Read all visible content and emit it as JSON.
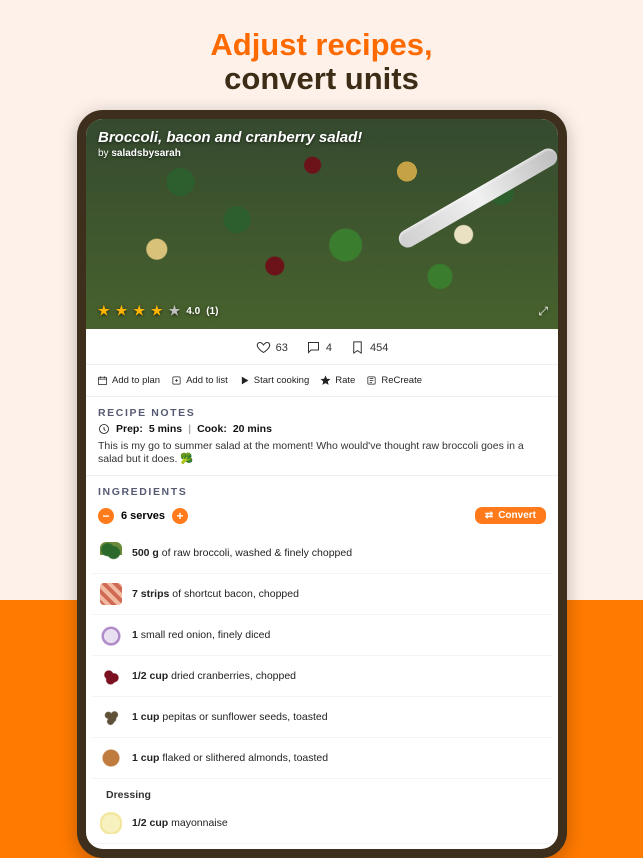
{
  "promo": {
    "line1": "Adjust recipes,",
    "line2": "convert units"
  },
  "hero": {
    "title": "Broccoli, bacon and cranberry salad!",
    "by_prefix": "by ",
    "author": "saladsbysarah",
    "rating_value": "4.0",
    "rating_count": "(1)"
  },
  "engagement": {
    "likes": "63",
    "comments": "4",
    "saves": "454"
  },
  "actions": {
    "add_to_plan": "Add to plan",
    "add_to_list": "Add to list",
    "start_cooking": "Start cooking",
    "rate": "Rate",
    "recreate": "ReCreate"
  },
  "notes": {
    "heading": "RECIPE NOTES",
    "prep_label": "Prep:",
    "prep_value": "5 mins",
    "cook_label": "Cook:",
    "cook_value": "20 mins",
    "text": "This is my go to summer salad at the moment! Who would've thought raw broccoli goes in a salad but it does. 🥦"
  },
  "ingredients_section": {
    "heading": "INGREDIENTS",
    "serves_label": "6 serves",
    "convert_label": "Convert",
    "items": [
      {
        "qty": "500 g",
        "rest": " of raw broccoli, washed & finely chopped"
      },
      {
        "qty": "7 strips",
        "rest": " of shortcut bacon, chopped"
      },
      {
        "qty": "1",
        "rest": " small red onion, finely diced"
      },
      {
        "qty": "1/2 cup",
        "rest": " dried cranberries, chopped"
      },
      {
        "qty": "1 cup",
        "rest": " pepitas or sunflower seeds, toasted"
      },
      {
        "qty": "1 cup",
        "rest": " flaked or slithered almonds, toasted"
      }
    ],
    "dressing_heading": "Dressing",
    "dressing_items": [
      {
        "qty": "1/2 cup",
        "rest": " mayonnaise"
      }
    ]
  }
}
